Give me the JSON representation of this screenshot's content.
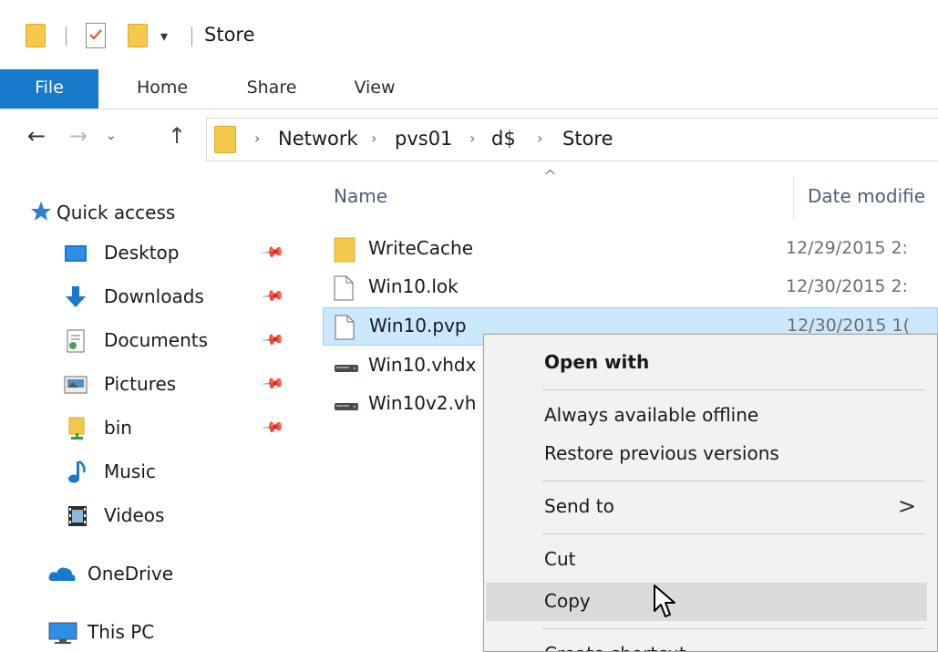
{
  "window": {
    "title": "Store",
    "quick_access_dropdown": "▾"
  },
  "ribbon": {
    "tabs": [
      {
        "label": "File"
      },
      {
        "label": "Home"
      },
      {
        "label": "Share"
      },
      {
        "label": "View"
      }
    ]
  },
  "address": {
    "breadcrumbs": [
      "Network",
      "pvs01",
      "d$",
      "Store"
    ],
    "separator": "›"
  },
  "nav_pane": {
    "quick_access": "Quick access",
    "items": [
      {
        "label": "Desktop",
        "icon": "desktop-icon",
        "pinned": true
      },
      {
        "label": "Downloads",
        "icon": "downloads-icon",
        "pinned": true
      },
      {
        "label": "Documents",
        "icon": "documents-icon",
        "pinned": true
      },
      {
        "label": "Pictures",
        "icon": "pictures-icon",
        "pinned": true
      },
      {
        "label": "bin",
        "icon": "folder-icon",
        "pinned": true
      },
      {
        "label": "Music",
        "icon": "music-icon",
        "pinned": false
      },
      {
        "label": "Videos",
        "icon": "videos-icon",
        "pinned": false
      }
    ],
    "onedrive": "OneDrive",
    "this_pc": "This PC"
  },
  "file_list": {
    "columns": {
      "name": "Name",
      "date_modified": "Date modifie"
    },
    "files": [
      {
        "name": "WriteCache",
        "date": "12/29/2015 2:",
        "icon": "folder-icon"
      },
      {
        "name": "Win10.lok",
        "date": "12/30/2015 2:",
        "icon": "file-icon"
      },
      {
        "name": "Win10.pvp",
        "date": "12/30/2015 1(",
        "icon": "file-icon",
        "selected": true
      },
      {
        "name": "Win10.vhdx",
        "date": ":",
        "icon": "drive-icon"
      },
      {
        "name": "Win10v2.vh",
        "date": ":",
        "icon": "drive-icon"
      }
    ]
  },
  "context_menu": {
    "items": {
      "open_with": "Open with",
      "always_offline": "Always available offline",
      "restore_versions": "Restore previous versions",
      "send_to": "Send to",
      "cut": "Cut",
      "copy": "Copy",
      "create_shortcut": "Create shortcut"
    },
    "submenu_arrow": ">",
    "hovered": "Copy"
  },
  "colors": {
    "accent": "#1979ca",
    "selection_bg": "#cce8ff",
    "selection_border": "#99d1ff",
    "menu_bg": "#f2f2f2",
    "menu_hover": "#dadada",
    "folder": "#f5c94c",
    "column_header": "#4c607a"
  }
}
